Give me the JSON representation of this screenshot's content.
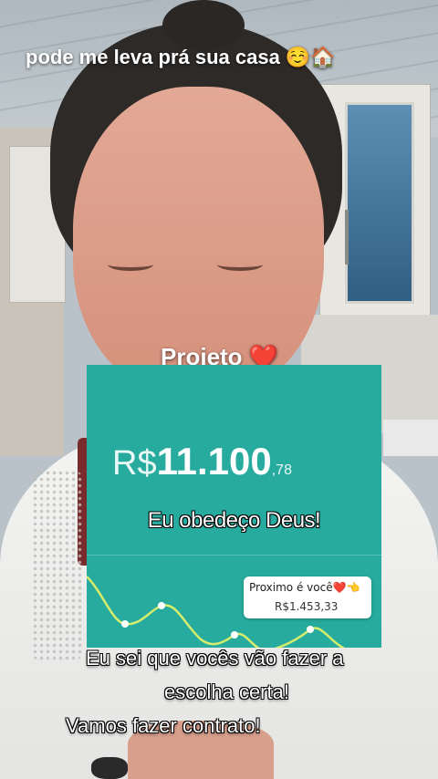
{
  "captions": {
    "top": "pode me leva prá sua casa ☺️🏠",
    "projeto": "Projeto ❤️",
    "bottom_line1": "Eu sei que vocês vão fazer a",
    "bottom_line2": "escolha certa!",
    "bottom_line3": "Vamos fazer contrato!"
  },
  "card": {
    "currency": "R$",
    "amount_main": "11.100",
    "amount_cents": ",78",
    "headline": "Eu obedeço Deus!",
    "tooltip_label": "Proximo é você",
    "tooltip_heart": "❤️",
    "tooltip_emoji": "👈",
    "tooltip_value": "R$1.453,33",
    "background_color": "#26ab9e",
    "line_color": "#d6ec6c"
  }
}
